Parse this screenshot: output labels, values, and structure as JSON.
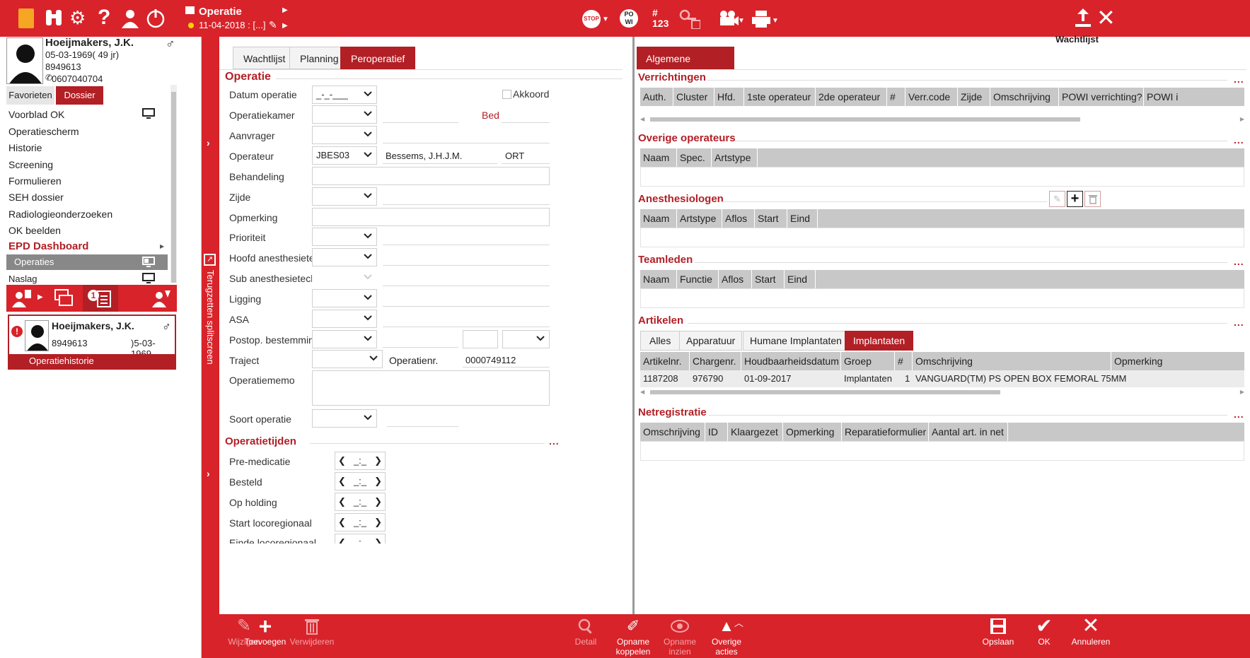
{
  "topbar": {
    "module_title": "Operatie",
    "date_label": "11-04-2018 : [...]",
    "wachtlijst": "Wachtlijst",
    "stop_label": "STOP",
    "po_wi_label": "PO\nWI",
    "count_label": "#\n123"
  },
  "patient": {
    "name": "Hoeijmakers, J.K.",
    "dob": "05-03-1969",
    "age": "( 49 jr)",
    "id": "8949613",
    "phone": "0607040704"
  },
  "leftnav": {
    "tabs": [
      "Favorieten",
      "Dossier"
    ],
    "items": [
      "Voorblad OK",
      "Operatiescherm",
      "Historie",
      "Screening",
      "Formulieren",
      "SEH dossier",
      "Radiologieonderzoeken",
      "OK beelden"
    ],
    "dashboard": "EPD Dashboard",
    "sub_items": [
      "Operaties",
      "Naslag"
    ]
  },
  "patient_card": {
    "name": "Hoeijmakers, J.K.",
    "id": "8949613",
    "dob": ")5-03-1969",
    "footer": "Operatiehistorie",
    "badge": "1"
  },
  "split_label": "Terugzetten splitscreen",
  "mid": {
    "tabs": [
      "Wachtlijst",
      "Planning",
      "Peroperatief"
    ],
    "section_operatie": "Operatie",
    "akkoord": "Akkoord",
    "bed": "Bed",
    "fields": {
      "datum": "Datum operatie",
      "datum_value": "_-_-___",
      "kamer": "Operatiekamer",
      "aanvrager": "Aanvrager",
      "operateur": "Operateur",
      "operateur_code": "JBES03",
      "operateur_name": "Bessems, J.H.J.M.",
      "operateur_spec": "ORT",
      "behandeling": "Behandeling",
      "zijde": "Zijde",
      "opmerking": "Opmerking",
      "prioriteit": "Prioriteit",
      "hoofd": "Hoofd anesthesietechniek",
      "sub": "Sub anesthesietechniek",
      "ligging": "Ligging",
      "asa": "ASA",
      "postop": "Postop. bestemming",
      "traject": "Traject",
      "operatienr_label": "Operatienr.",
      "operatienr": "0000749112",
      "memo": "Operatiememo",
      "soort": "Soort operatie"
    },
    "section_tijden": "Operatietijden",
    "tijden": [
      "Pre-medicatie",
      "Besteld",
      "Op holding",
      "Start locoregionaal",
      "Einde locoregionaal"
    ],
    "time_placeholder": "_:_"
  },
  "right": {
    "tab": "Algemene gegevens",
    "verrichtingen": {
      "title": "Verrichtingen",
      "cols": [
        "Auth.",
        "Cluster",
        "Hfd.",
        "1ste operateur",
        "2de operateur",
        "#",
        "Verr.code",
        "Zijde",
        "Omschrijving",
        "POWI verrichting?",
        "POWI i"
      ]
    },
    "overige": {
      "title": "Overige operateurs",
      "cols": [
        "Naam",
        "Spec.",
        "Artstype"
      ]
    },
    "anesthesiologen": {
      "title": "Anesthesiologen",
      "cols": [
        "Naam",
        "Artstype",
        "Aflos",
        "Start",
        "Eind"
      ]
    },
    "teamleden": {
      "title": "Teamleden",
      "cols": [
        "Naam",
        "Functie",
        "Aflos",
        "Start",
        "Eind"
      ]
    },
    "artikelen": {
      "title": "Artikelen",
      "tabs": [
        "Alles",
        "Apparatuur",
        "Humane Implantaten",
        "Implantaten"
      ],
      "cols": [
        "Artikelnr.",
        "Chargenr.",
        "Houdbaarheidsdatum",
        "Groep",
        "#",
        "Omschrijving",
        "Opmerking"
      ],
      "row": [
        "1187208",
        "976790",
        "01-09-2017",
        "Implantaten",
        "1",
        "VANGUARD(TM) PS OPEN BOX FEMORAL 75MM",
        ""
      ]
    },
    "netregistratie": {
      "title": "Netregistratie",
      "cols": [
        "Omschrijving",
        "ID",
        "Klaargezet",
        "Opmerking",
        "Reparatieformulier",
        "Aantal art. in net"
      ]
    }
  },
  "bottombar": {
    "wijzigen": "Wijzigen",
    "toevoegen": "Toevoegen",
    "verwijderen": "Verwijderen",
    "detail": "Detail",
    "opname_koppelen": "Opname\nkoppelen",
    "opname_inzien": "Opname\ninzien",
    "overige_acties": "Overige\nacties",
    "opslaan": "Opslaan",
    "ok": "OK",
    "annuleren": "Annuleren"
  },
  "colors": {
    "brand_red": "#d8232a",
    "dark_red": "#b21f25",
    "grid_header": "#c8c8c8"
  }
}
